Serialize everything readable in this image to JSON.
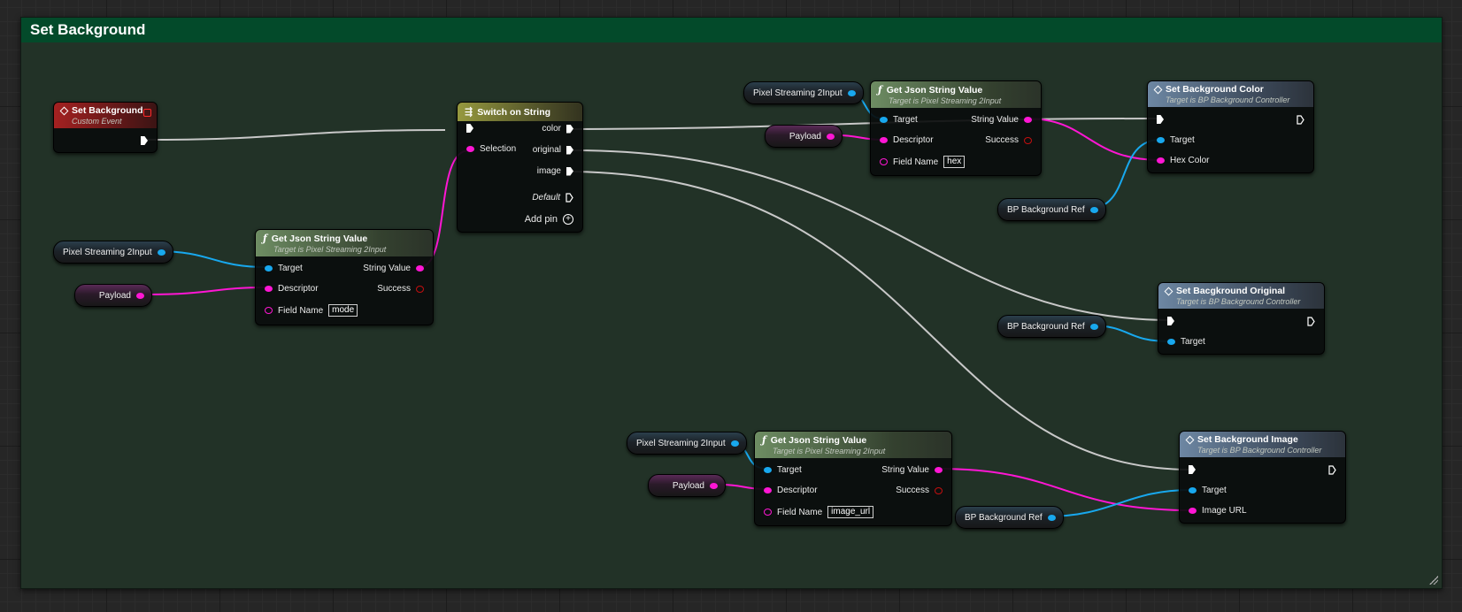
{
  "comment": {
    "title": "Set Background"
  },
  "colors": {
    "exec": "#ffffff",
    "object": "#18a8ee",
    "string": "#ff16d4",
    "bool": "#c40f0f"
  },
  "event": {
    "title": "Set Background",
    "subtitle": "Custom Event"
  },
  "switch": {
    "title": "Switch on String",
    "selection": "Selection",
    "out_color": "color",
    "out_original": "original",
    "out_image": "image",
    "default": "Default",
    "add_pin": "Add pin"
  },
  "json_mode": {
    "title": "Get Json String Value",
    "subtitle": "Target is Pixel Streaming 2Input",
    "target": "Target",
    "descriptor": "Descriptor",
    "field_name_label": "Field Name",
    "field_name_value": "mode",
    "string_value": "String Value",
    "success": "Success"
  },
  "json_hex": {
    "title": "Get Json String Value",
    "subtitle": "Target is Pixel Streaming 2Input",
    "target": "Target",
    "descriptor": "Descriptor",
    "field_name_label": "Field Name",
    "field_name_value": "hex",
    "string_value": "String Value",
    "success": "Success"
  },
  "json_url": {
    "title": "Get Json String Value",
    "subtitle": "Target is Pixel Streaming 2Input",
    "target": "Target",
    "descriptor": "Descriptor",
    "field_name_label": "Field Name",
    "field_name_value": "image_url",
    "string_value": "String Value",
    "success": "Success"
  },
  "set_color": {
    "title": "Set Background Color",
    "subtitle": "Target is BP Background Controller",
    "target": "Target",
    "param": "Hex Color"
  },
  "set_original": {
    "title": "Set Bacgkround Original",
    "subtitle": "Target is BP Background Controller",
    "target": "Target"
  },
  "set_image": {
    "title": "Set Background Image",
    "subtitle": "Target is BP Background Controller",
    "target": "Target",
    "param": "Image URL"
  },
  "vars": {
    "ps_left": "Pixel Streaming 2Input",
    "payload_left": "Payload",
    "ps_top": "Pixel Streaming 2Input",
    "payload_top": "Payload",
    "bp_ref_color": "BP Background Ref",
    "bp_ref_original": "BP Background Ref",
    "ps_bottom": "Pixel Streaming 2Input",
    "payload_bottom": "Payload",
    "bp_ref_image": "BP Background Ref"
  }
}
